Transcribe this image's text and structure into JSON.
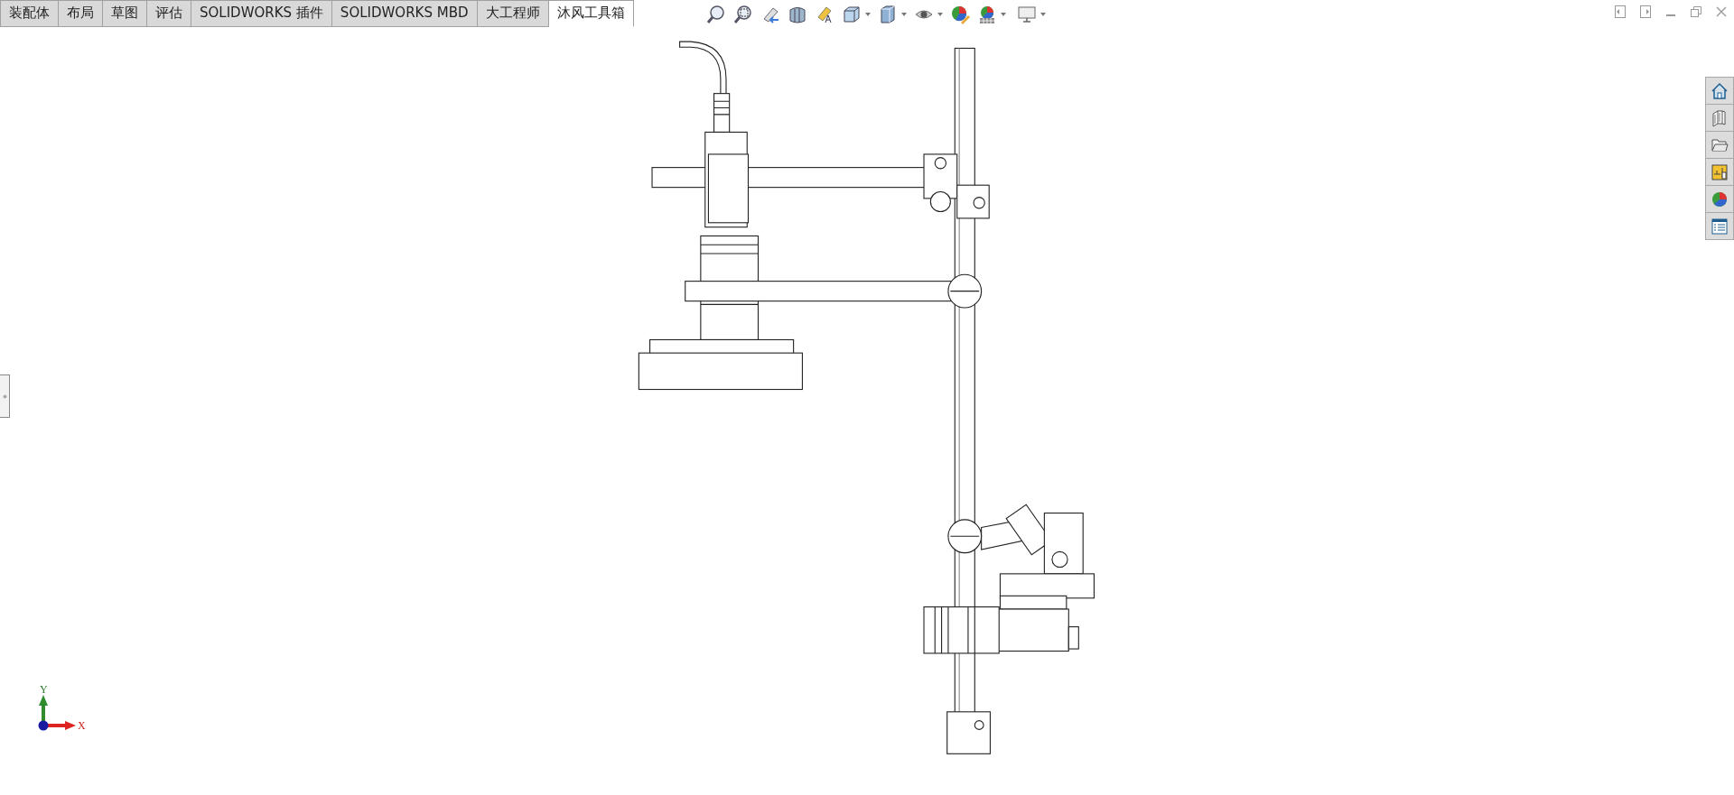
{
  "tabs": [
    {
      "label": "装配体",
      "selected": false
    },
    {
      "label": "布局",
      "selected": false
    },
    {
      "label": "草图",
      "selected": false
    },
    {
      "label": "评估",
      "selected": false
    },
    {
      "label": "SOLIDWORKS 插件",
      "selected": false
    },
    {
      "label": "SOLIDWORKS MBD",
      "selected": false
    },
    {
      "label": "大工程师",
      "selected": false
    },
    {
      "label": "沐风工具箱",
      "selected": true
    }
  ],
  "triad": {
    "y_label": "Y",
    "x_label": "X"
  }
}
